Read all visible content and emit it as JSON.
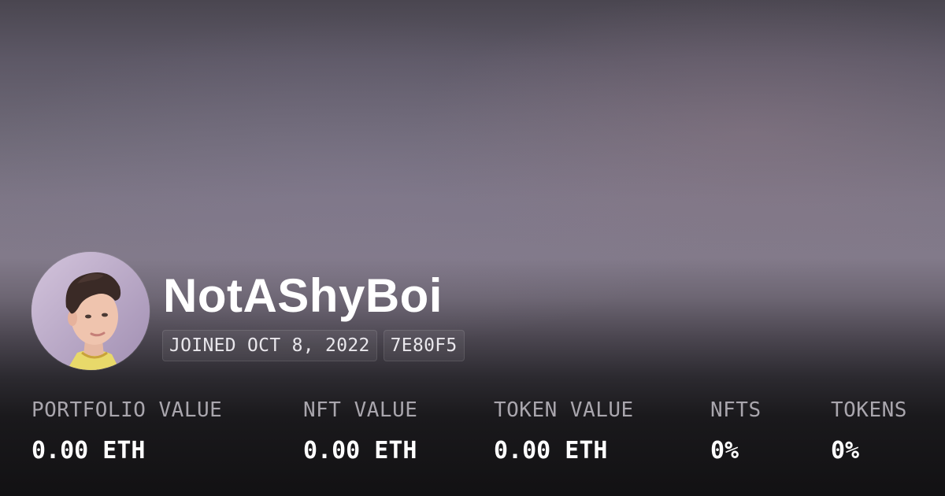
{
  "profile": {
    "username": "NotAShyBoi",
    "joined": "JOINED OCT 8, 2022",
    "address_short": "7E80F5"
  },
  "avatar": {
    "icon": "profile-photo"
  },
  "stats": [
    {
      "label": "PORTFOLIO VALUE",
      "value": "0.00 ETH"
    },
    {
      "label": "NFT VALUE",
      "value": "0.00 ETH"
    },
    {
      "label": "TOKEN VALUE",
      "value": "0.00 ETH"
    },
    {
      "label": "NFTS",
      "value": "0%"
    },
    {
      "label": "TOKENS",
      "value": "0%"
    }
  ],
  "colors": {
    "text_primary": "#ffffff",
    "text_muted": "#a9a6ad",
    "background_top": "#4a4650",
    "background_bottom": "#121113"
  }
}
